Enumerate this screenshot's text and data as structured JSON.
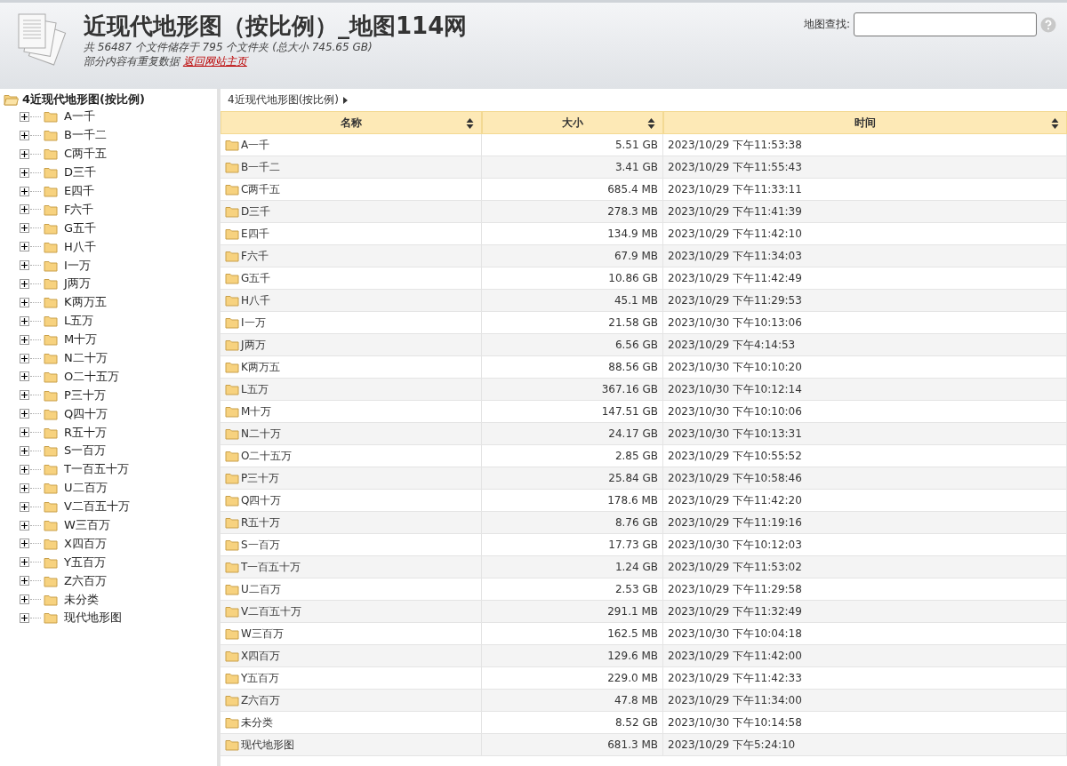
{
  "header": {
    "title": "近现代地形图（按比例）_地图114网",
    "summary": "共 56487 个文件储存于 795 个文件夹 (总大小 745.65 GB)",
    "note": "部分内容有重复数据",
    "home_link": "返回网站主页",
    "search_label": "地图查找:"
  },
  "tree": {
    "root": "4近现代地形图(按比例)",
    "expanded": true,
    "items": [
      {
        "label": "A一千",
        "expanded": false
      },
      {
        "label": "B一千二",
        "expanded": false
      },
      {
        "label": "C两千五",
        "expanded": false
      },
      {
        "label": "D三千",
        "expanded": false
      },
      {
        "label": "E四千",
        "expanded": false
      },
      {
        "label": "F六千",
        "expanded": false
      },
      {
        "label": "G五千",
        "expanded": false
      },
      {
        "label": "H八千",
        "expanded": false
      },
      {
        "label": "I一万",
        "expanded": false
      },
      {
        "label": "J两万",
        "expanded": false
      },
      {
        "label": "K两万五",
        "expanded": false
      },
      {
        "label": "L五万",
        "expanded": false
      },
      {
        "label": "M十万",
        "expanded": false
      },
      {
        "label": "N二十万",
        "expanded": false
      },
      {
        "label": "O二十五万",
        "expanded": false
      },
      {
        "label": "P三十万",
        "expanded": false
      },
      {
        "label": "Q四十万",
        "expanded": false
      },
      {
        "label": "R五十万",
        "expanded": false
      },
      {
        "label": "S一百万",
        "expanded": false
      },
      {
        "label": "T一百五十万",
        "expanded": false
      },
      {
        "label": "U二百万",
        "expanded": false
      },
      {
        "label": "V二百五十万",
        "expanded": false
      },
      {
        "label": "W三百万",
        "expanded": false
      },
      {
        "label": "X四百万",
        "expanded": false
      },
      {
        "label": "Y五百万",
        "expanded": false
      },
      {
        "label": "Z六百万",
        "expanded": false
      },
      {
        "label": "未分类",
        "expanded": false
      },
      {
        "label": "现代地形图",
        "expanded": false
      }
    ]
  },
  "breadcrumb": "4近现代地形图(按比例)",
  "table": {
    "columns": [
      "名称",
      "大小",
      "时间"
    ],
    "rows": [
      [
        "A一千",
        "5.51 GB",
        "2023/10/29 下午11:53:38"
      ],
      [
        "B一千二",
        "3.41 GB",
        "2023/10/29 下午11:55:43"
      ],
      [
        "C两千五",
        "685.4 MB",
        "2023/10/29 下午11:33:11"
      ],
      [
        "D三千",
        "278.3 MB",
        "2023/10/29 下午11:41:39"
      ],
      [
        "E四千",
        "134.9 MB",
        "2023/10/29 下午11:42:10"
      ],
      [
        "F六千",
        "67.9 MB",
        "2023/10/29 下午11:34:03"
      ],
      [
        "G五千",
        "10.86 GB",
        "2023/10/29 下午11:42:49"
      ],
      [
        "H八千",
        "45.1 MB",
        "2023/10/29 下午11:29:53"
      ],
      [
        "I一万",
        "21.58 GB",
        "2023/10/30 下午10:13:06"
      ],
      [
        "J两万",
        "6.56 GB",
        "2023/10/29 下午4:14:53"
      ],
      [
        "K两万五",
        "88.56 GB",
        "2023/10/30 下午10:10:20"
      ],
      [
        "L五万",
        "367.16 GB",
        "2023/10/30 下午10:12:14"
      ],
      [
        "M十万",
        "147.51 GB",
        "2023/10/30 下午10:10:06"
      ],
      [
        "N二十万",
        "24.17 GB",
        "2023/10/30 下午10:13:31"
      ],
      [
        "O二十五万",
        "2.85 GB",
        "2023/10/29 下午10:55:52"
      ],
      [
        "P三十万",
        "25.84 GB",
        "2023/10/29 下午10:58:46"
      ],
      [
        "Q四十万",
        "178.6 MB",
        "2023/10/29 下午11:42:20"
      ],
      [
        "R五十万",
        "8.76 GB",
        "2023/10/29 下午11:19:16"
      ],
      [
        "S一百万",
        "17.73 GB",
        "2023/10/30 下午10:12:03"
      ],
      [
        "T一百五十万",
        "1.24 GB",
        "2023/10/29 下午11:53:02"
      ],
      [
        "U二百万",
        "2.53 GB",
        "2023/10/29 下午11:29:58"
      ],
      [
        "V二百五十万",
        "291.1 MB",
        "2023/10/29 下午11:32:49"
      ],
      [
        "W三百万",
        "162.5 MB",
        "2023/10/30 下午10:04:18"
      ],
      [
        "X四百万",
        "129.6 MB",
        "2023/10/29 下午11:42:00"
      ],
      [
        "Y五百万",
        "229.0 MB",
        "2023/10/29 下午11:42:33"
      ],
      [
        "Z六百万",
        "47.8 MB",
        "2023/10/29 下午11:34:00"
      ],
      [
        "未分类",
        "8.52 GB",
        "2023/10/30 下午10:14:58"
      ],
      [
        "现代地形图",
        "681.3 MB",
        "2023/10/29 下午5:24:10"
      ]
    ]
  }
}
